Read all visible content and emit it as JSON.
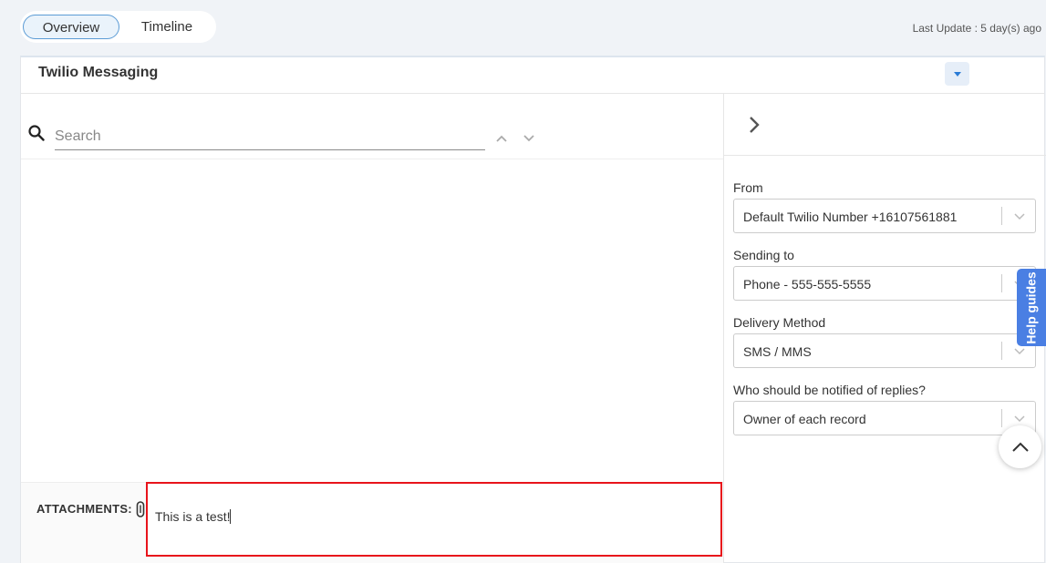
{
  "tabs": [
    {
      "label": "Overview",
      "active": true
    },
    {
      "label": "Timeline",
      "active": false
    }
  ],
  "last_update": "Last Update : 5 day(s) ago",
  "panel": {
    "title": "Twilio Messaging"
  },
  "search": {
    "placeholder": "Search",
    "value": ""
  },
  "attachments": {
    "label": "ATTACHMENTS:",
    "message": "This is a test!"
  },
  "form": {
    "from": {
      "label": "From",
      "value": "Default Twilio Number +16107561881"
    },
    "sending_to": {
      "label": "Sending to",
      "value": "Phone - 555-555-5555"
    },
    "delivery_method": {
      "label": "Delivery Method",
      "value": "SMS / MMS"
    },
    "notify": {
      "label": "Who should be notified of replies?",
      "value": "Owner of each record"
    }
  },
  "help": {
    "label": "Help guides"
  },
  "colors": {
    "accent": "#2a7bd6",
    "help_tab": "#4a7fe3",
    "highlight_border": "#e8141b"
  },
  "icons": [
    "search-icon",
    "chevron-up-icon",
    "chevron-down-icon",
    "chevron-right-icon",
    "paperclip-icon",
    "caret-down-icon",
    "arrow-up-icon"
  ]
}
